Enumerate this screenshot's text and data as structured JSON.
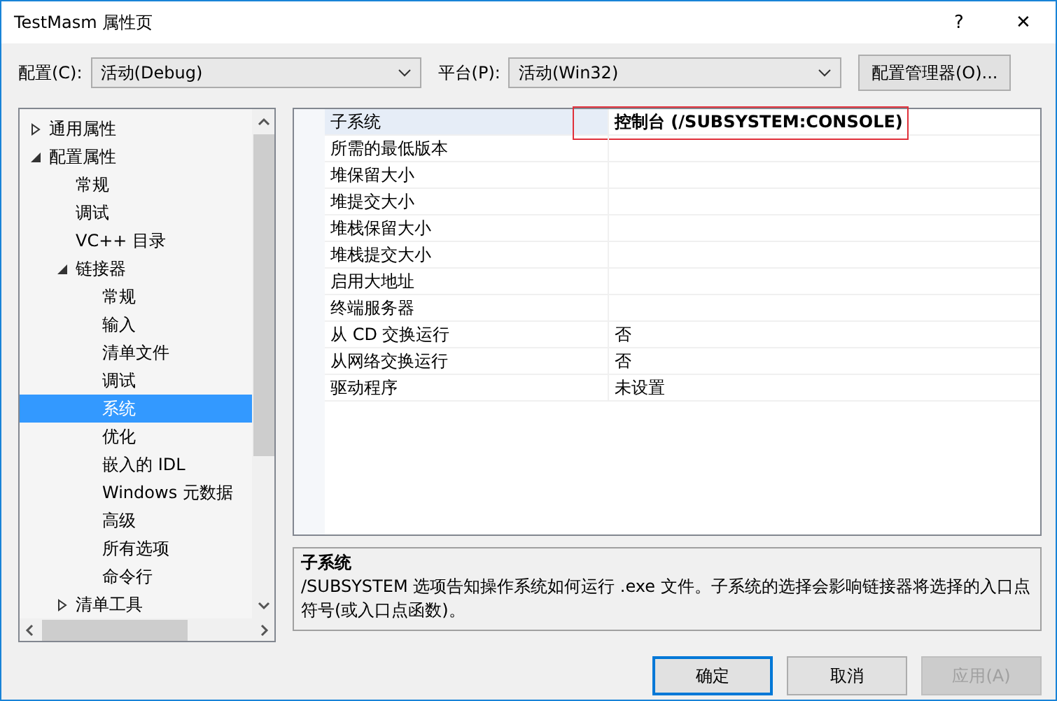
{
  "window": {
    "title": "TestMasm 属性页",
    "help": "?",
    "close": "✕"
  },
  "toolbar": {
    "config_label": "配置(C):",
    "config_value": "活动(Debug)",
    "platform_label": "平台(P):",
    "platform_value": "活动(Win32)",
    "manager_button": "配置管理器(O)..."
  },
  "tree": {
    "items": [
      {
        "label": "通用属性",
        "expanded": false,
        "selected": false
      },
      {
        "label": "配置属性",
        "expanded": true,
        "selected": false,
        "children": [
          {
            "label": "常规",
            "selected": false
          },
          {
            "label": "调试",
            "selected": false
          },
          {
            "label": "VC++ 目录",
            "selected": false
          },
          {
            "label": "链接器",
            "expanded": true,
            "selected": false,
            "children": [
              {
                "label": "常规",
                "selected": false
              },
              {
                "label": "输入",
                "selected": false
              },
              {
                "label": "清单文件",
                "selected": false
              },
              {
                "label": "调试",
                "selected": false
              },
              {
                "label": "系统",
                "selected": true
              },
              {
                "label": "优化",
                "selected": false
              },
              {
                "label": "嵌入的 IDL",
                "selected": false
              },
              {
                "label": "Windows 元数据",
                "selected": false
              },
              {
                "label": "高级",
                "selected": false
              },
              {
                "label": "所有选项",
                "selected": false
              },
              {
                "label": "命令行",
                "selected": false
              }
            ]
          },
          {
            "label": "清单工具",
            "expanded": false,
            "selected": false
          }
        ]
      }
    ]
  },
  "properties": [
    {
      "name": "子系统",
      "value": "控制台 (/SUBSYSTEM:CONSOLE)",
      "selected": true,
      "highlighted": true
    },
    {
      "name": "所需的最低版本",
      "selected": false,
      "highlighted": false
    },
    {
      "name": "堆保留大小",
      "selected": false,
      "highlighted": false
    },
    {
      "name": "堆提交大小",
      "selected": false,
      "highlighted": false
    },
    {
      "name": "堆栈保留大小",
      "selected": false,
      "highlighted": false
    },
    {
      "name": "堆栈提交大小",
      "selected": false,
      "highlighted": false
    },
    {
      "name": "启用大地址",
      "selected": false,
      "highlighted": false
    },
    {
      "name": "终端服务器",
      "selected": false,
      "highlighted": false
    },
    {
      "name": "从 CD 交换运行",
      "value": "否",
      "selected": false,
      "highlighted": false
    },
    {
      "name": "从网络交换运行",
      "value": "否",
      "selected": false,
      "highlighted": false
    },
    {
      "name": "驱动程序",
      "value": "未设置",
      "selected": false,
      "highlighted": false
    }
  ],
  "description": {
    "title": "子系统",
    "text": "/SUBSYSTEM 选项告知操作系统如何运行 .exe 文件。子系统的选择会影响链接器将选择的入口点符号(或入口点函数)。"
  },
  "buttons": [
    {
      "label": "确定",
      "kind": "default",
      "disabled": false
    },
    {
      "label": "取消",
      "kind": "normal",
      "disabled": false
    },
    {
      "label": "应用(A)",
      "kind": "normal",
      "disabled": true
    }
  ]
}
